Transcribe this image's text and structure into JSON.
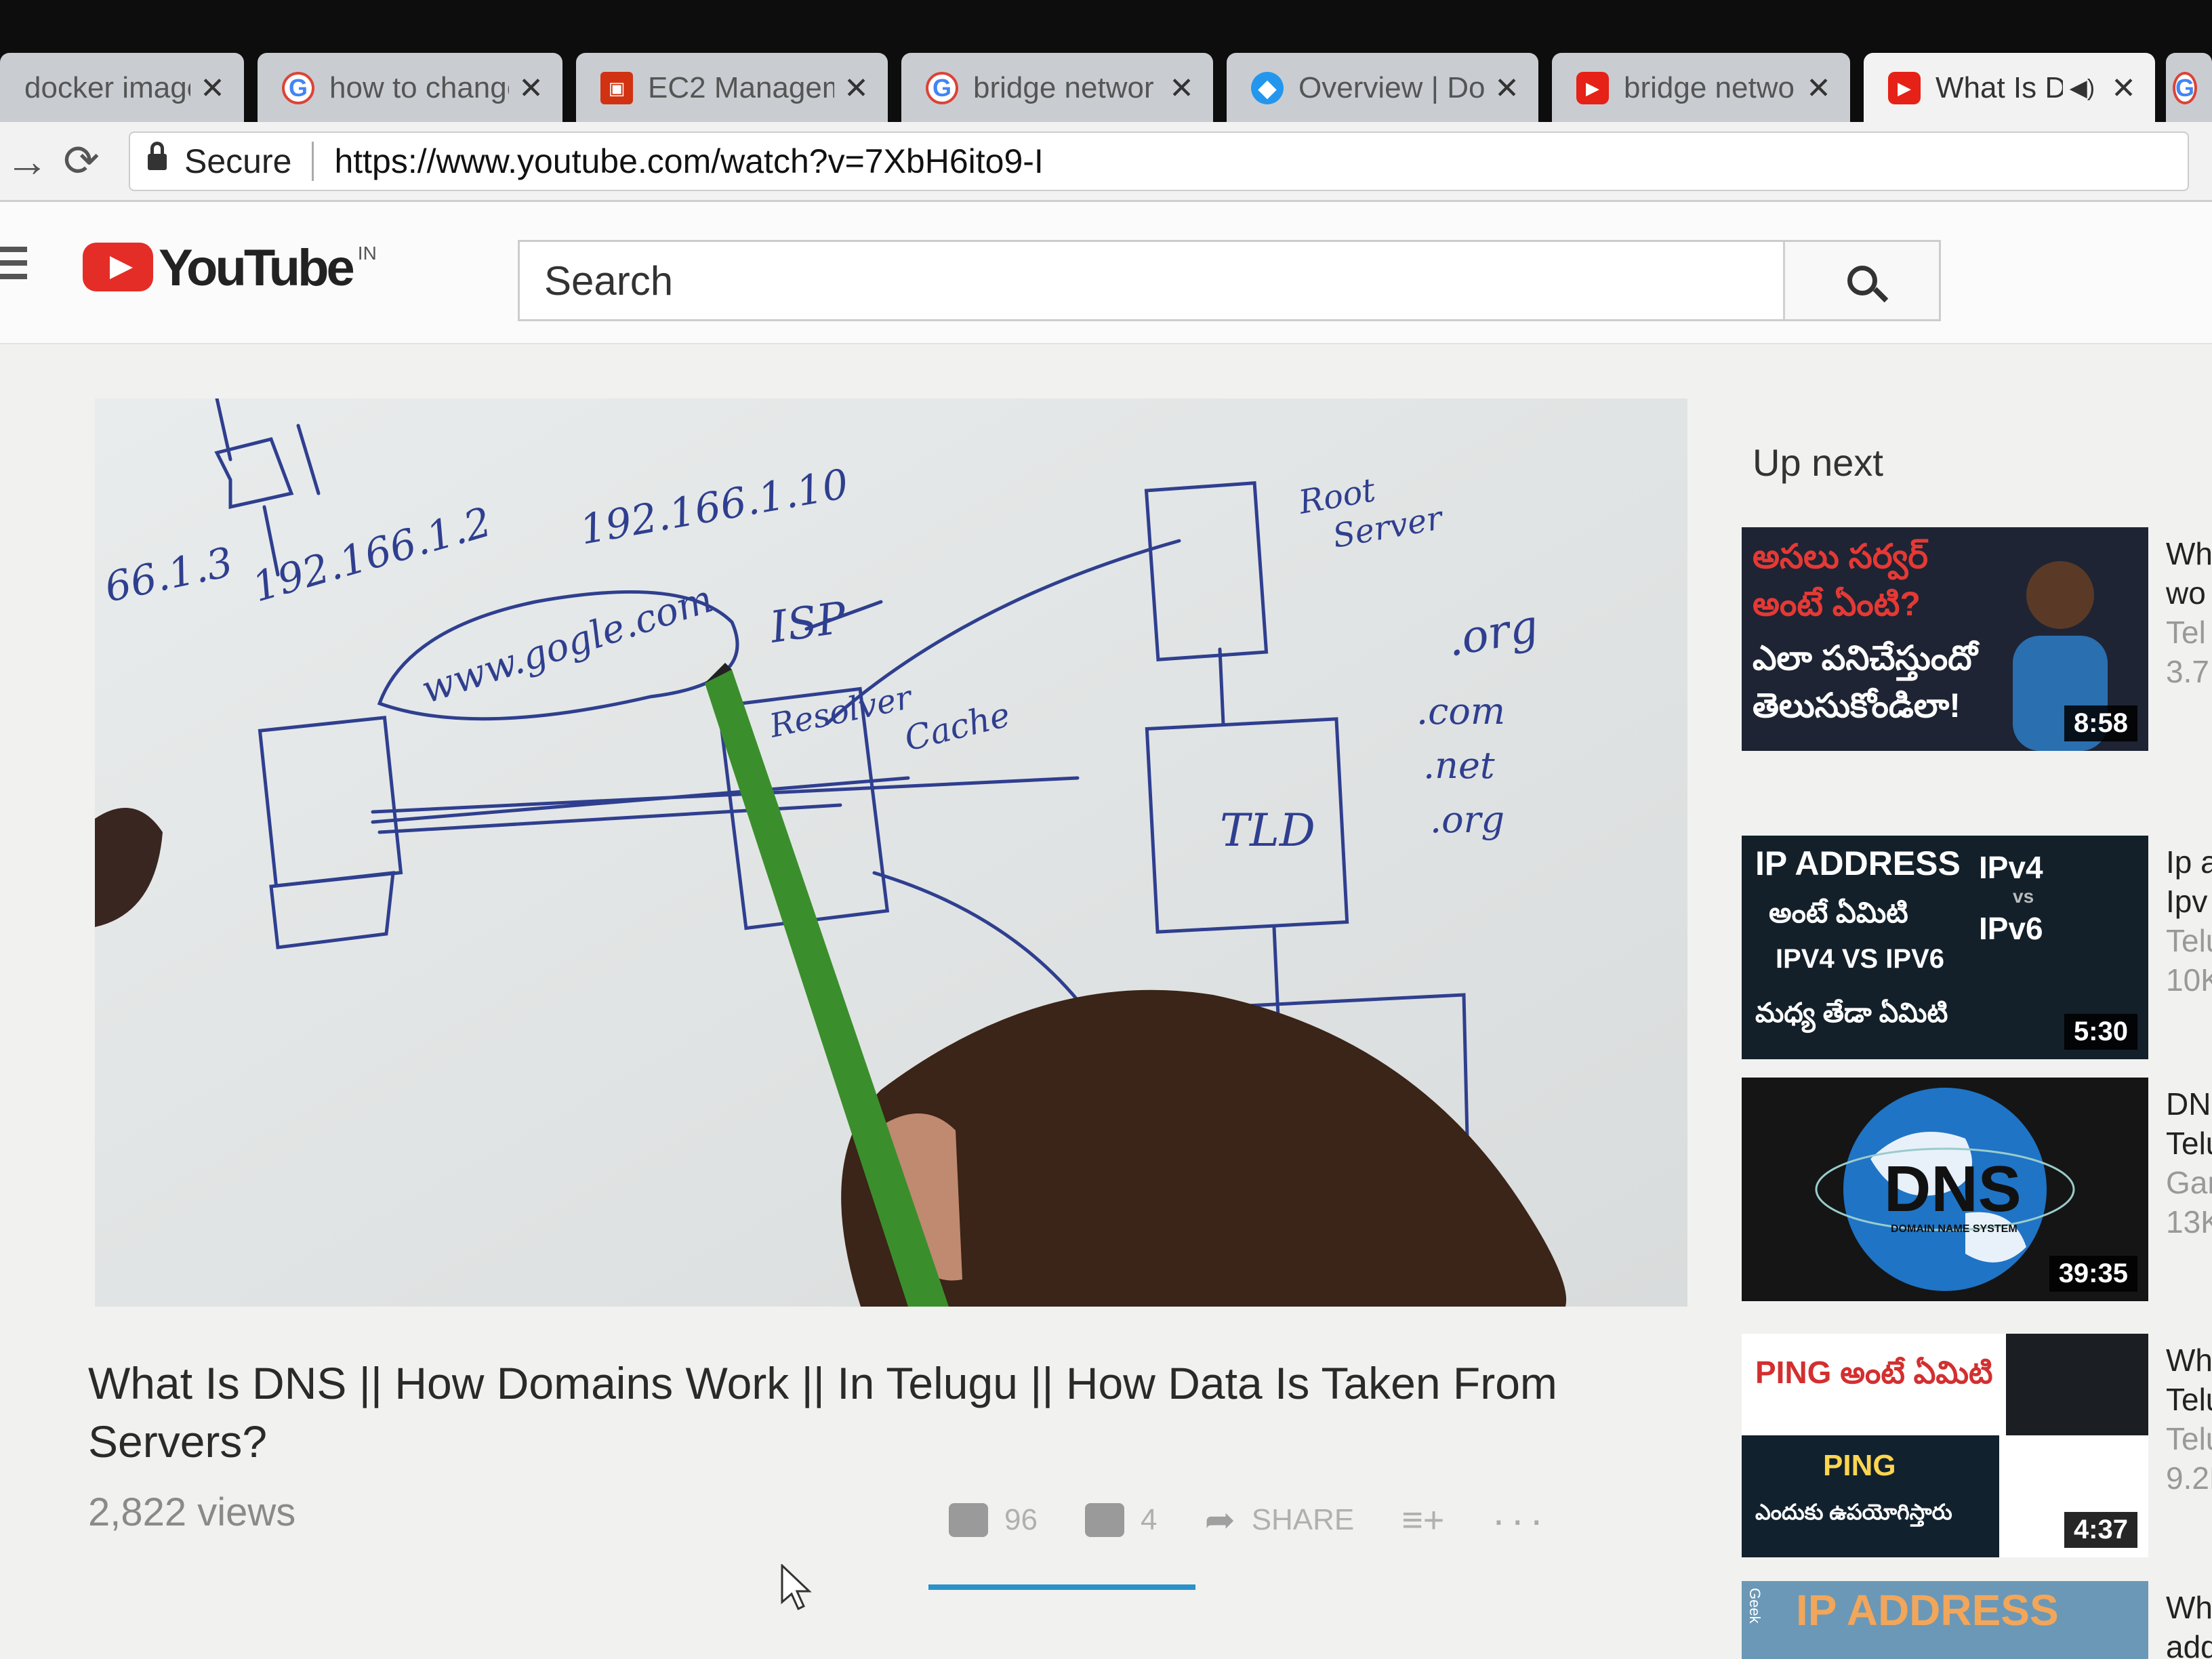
{
  "browser": {
    "tabs": [
      {
        "title": "docker image",
        "favicon": "docker-icon",
        "close": "✕"
      },
      {
        "title": "how to change",
        "favicon": "google-icon",
        "close": "✕"
      },
      {
        "title": "EC2 Managem",
        "favicon": "aws-icon",
        "close": "✕"
      },
      {
        "title": "bridge networ",
        "favicon": "google-icon",
        "close": "✕"
      },
      {
        "title": "Overview | Doc",
        "favicon": "docker-icon",
        "close": "✕"
      },
      {
        "title": "bridge networ",
        "favicon": "youtube-icon",
        "close": "✕"
      },
      {
        "title": "What Is DN",
        "favicon": "youtube-icon",
        "close": "✕",
        "active": true,
        "audio": "◀)"
      }
    ],
    "address": {
      "secure_label": "Secure",
      "url": "https://www.youtube.com/watch?v=7XbH6ito9-I"
    }
  },
  "youtube": {
    "logo_text": "YouTube",
    "country_code": "IN",
    "search_placeholder": "Search",
    "video": {
      "title": "What Is DNS || How Domains Work || In Telugu || How Data Is Taken From Servers?",
      "views": "2,822 views",
      "likes": "96",
      "dislikes": "4",
      "share_label": "SHARE",
      "sentiment_fraction": 0.96,
      "whiteboard": {
        "ip_1": "66.1.3",
        "ip_2": "192.166.1.2",
        "ip_3": "192.166.1.10",
        "domain": "www.gogle.com",
        "isp": "ISP",
        "resolver": "Resolver",
        "cache": "Cache",
        "root": "Root",
        "server": "Server",
        "tld": "TLD",
        "org_top": ".org",
        "com": ".com",
        "net": ".net",
        "org": ".org"
      }
    },
    "sidebar": {
      "up_next_label": "Up next",
      "recommendations": [
        {
          "thumb_lines": [
            "అసలు సర్వర్",
            "అంటే ఏంటి?",
            "ఎలా పనిచేస్తుందో",
            "తెలుసుకోండిలా!"
          ],
          "duration": "8:58",
          "title": "Wh",
          "line2": "wo",
          "channel": "Tel",
          "views": "3.7"
        },
        {
          "thumb_lines": [
            "IP ADDRESS",
            "అంటే ఏమిటి",
            "IPV4 VS IPV6",
            "మధ్య తేడా ఏమిటి",
            "IPv4",
            "vs",
            "IPv6"
          ],
          "duration": "5:30",
          "title": "Ip a",
          "line2": "Ipv",
          "channel": "Telu",
          "views": "10K"
        },
        {
          "thumb_lines": [
            "DNS",
            "DOMAIN NAME SYSTEM"
          ],
          "duration": "39:35",
          "title": "DNS",
          "line2": "Telu",
          "channel": "Gan",
          "views": "13K"
        },
        {
          "thumb_lines": [
            "PING అంటే ఏమిటి",
            "PING",
            "ఎందుకు ఉపయోగిస్తారు"
          ],
          "duration": "4:37",
          "title": "Wha",
          "line2": "Telu",
          "channel": "Telu",
          "views": "9.2K"
        },
        {
          "thumb_lines": [
            "IP ADDRESS",
            "Geek"
          ],
          "duration": "",
          "title": "Wha",
          "line2": "addr",
          "channel": "",
          "views": ""
        }
      ]
    }
  },
  "colors": {
    "youtube_red": "#e52d27",
    "sentiment_blue": "#2a92c9",
    "pen_green": "#3a8f2c"
  }
}
